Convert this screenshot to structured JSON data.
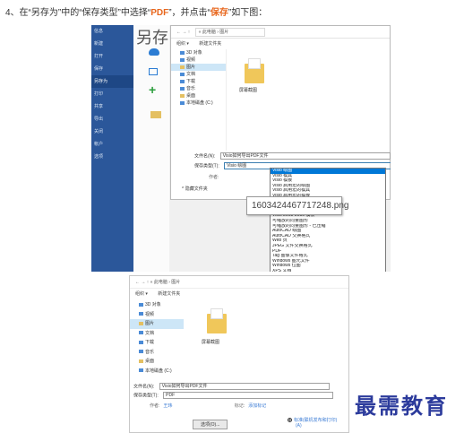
{
  "instruction": {
    "prefix": "4、在“另存为”中的“保存类型”中选择“",
    "highlight1": "PDF",
    "middle": "”，并点击“",
    "highlight2": "保存",
    "suffix": "”如下图："
  },
  "accent_color": "#e8661c",
  "shot1": {
    "sidebar_items": [
      "信息",
      "新建",
      "打开",
      "保存",
      "另存为",
      "打印",
      "共享",
      "导出",
      "关闭",
      "帐户",
      "选项"
    ],
    "sidebar_active_index": 4,
    "saveas_title": "另存",
    "address": "« 此电脑 › 图片",
    "toolbar": {
      "organize": "组织 ▾",
      "new_folder": "新建文件夹"
    },
    "nav_items": [
      {
        "label": "3D 对象",
        "icon": "cube-icon"
      },
      {
        "label": "视频",
        "icon": "video-icon"
      },
      {
        "label": "图片",
        "icon": "pictures-icon"
      },
      {
        "label": "文档",
        "icon": "document-icon"
      },
      {
        "label": "下载",
        "icon": "download-icon"
      },
      {
        "label": "音乐",
        "icon": "music-icon"
      },
      {
        "label": "桌面",
        "icon": "desktop-icon"
      },
      {
        "label": "本地磁盘 (C:)",
        "icon": "drive-icon"
      }
    ],
    "nav_selected_index": 2,
    "folder_caption": "屏幕截图",
    "filename_label": "文件名(N):",
    "filename_value": "Visio如何导出PDF文件",
    "filetype_label": "保存类型(T):",
    "filetype_value": "Visio 绘图",
    "author_label": "作者:",
    "hide_folders": "^ 隐藏文件夹",
    "dropdown_options": [
      "Visio 绘图",
      "Visio 模具",
      "Visio 模板",
      "Visio 启用宏的绘图",
      "Visio 启用宏的模具",
      "Visio 启用宏的模板",
      "Visio 2003-2010 绘图",
      "Visio 2010 Web 绘图",
      "Visio 2003-2010 模具",
      "Visio 2003-2010 模板",
      "可缩放的向量图形",
      "可缩放的向量图形 - 已压缩",
      "AutoCAD 绘图",
      "AutoCAD 交换格式",
      "Web 页",
      "JPEG 文件交换格式",
      "PDF",
      "Tag 图像文件格式",
      "Windows 图元文件",
      "Windows 位图",
      "XPS 文档"
    ],
    "dropdown_selected_index": 0,
    "tooltip": "1603424467717248.png"
  },
  "shot2": {
    "address": "« 此电脑 › 图片",
    "toolbar": {
      "organize": "组织 ▾",
      "new_folder": "新建文件夹"
    },
    "nav_items": [
      {
        "label": "3D 对象",
        "icon": "cube-icon"
      },
      {
        "label": "视频",
        "icon": "video-icon"
      },
      {
        "label": "图片",
        "icon": "pictures-icon"
      },
      {
        "label": "文档",
        "icon": "document-icon"
      },
      {
        "label": "下载",
        "icon": "download-icon"
      },
      {
        "label": "音乐",
        "icon": "music-icon"
      },
      {
        "label": "桌面",
        "icon": "desktop-icon"
      },
      {
        "label": "本地磁盘 (C:)",
        "icon": "drive-icon"
      }
    ],
    "nav_selected_index": 2,
    "folder_caption": "屏幕截图",
    "filename_label": "文件名(N):",
    "filename_value": "Visio如何导出PDF文件",
    "filetype_label": "保存类型(T):",
    "filetype_value": "PDF",
    "author_label": "作者:",
    "author_value": "王玮",
    "tags_label": "标记:",
    "tags_value": "添加标记",
    "options_button": "选项(O)...",
    "radio_label": "标准(联机发布和打印)",
    "radio_label2": "(A)"
  },
  "logo_text": "最需教育",
  "logo_color": "#2c3b9c"
}
